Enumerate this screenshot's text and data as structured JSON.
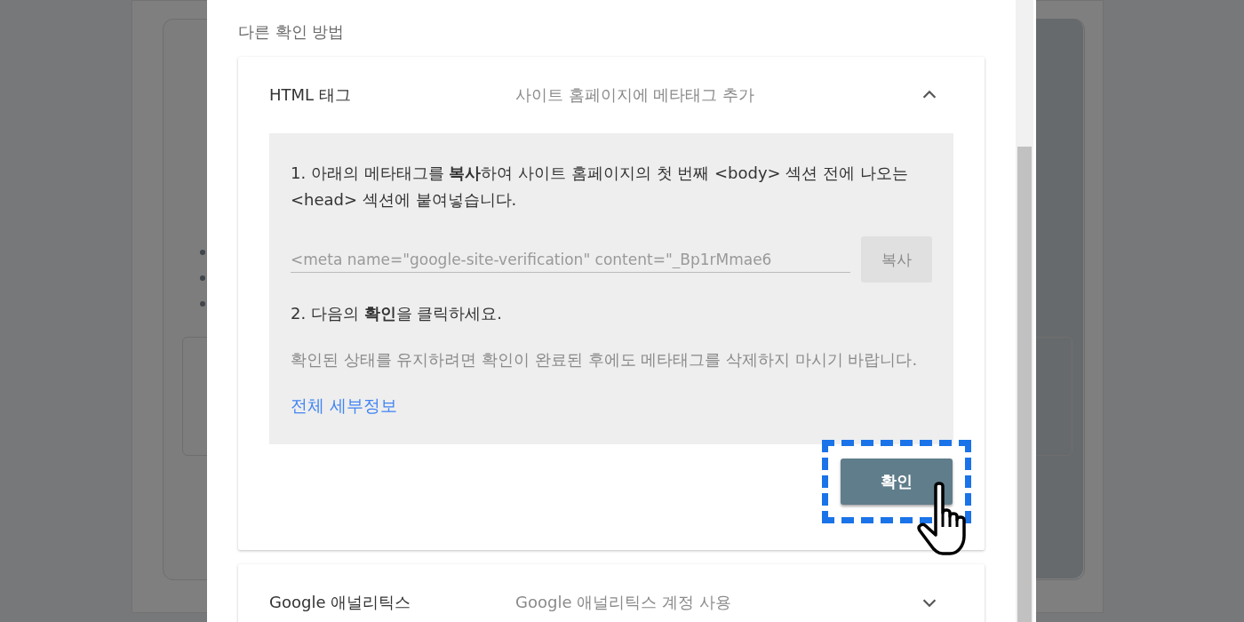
{
  "heading": "다른 확인 방법",
  "methods": [
    {
      "title": "HTML 태그",
      "subtitle": "사이트 홈페이지에 메타태그 추가",
      "expanded": true,
      "step_1": "1. 아래의 메타태그를 **복사**하여 사이트 홈페이지의 첫 번째 <body> 섹션 전에 나오는 <head> 섹션에 붙여넣습니다.",
      "meta_tag": {
        "value": "<meta name=\"google-site-verification\" content=\"_Bp1rMmae6"
      },
      "copy_button": "복사",
      "step_2": "2. 다음의 **확인**을 클릭하세요.",
      "note": "확인된 상태를 유지하려면 확인이 완료된 후에도 메타태그를 삭제하지 마시기 바랍니다.",
      "details_link": "전체 세부정보",
      "verify_button": {
        "label": "확인",
        "focused": true
      }
    },
    {
      "title": "Google 애널리틱스",
      "subtitle": "Google 애널리틱스 계정 사용",
      "expanded": false
    }
  ]
}
